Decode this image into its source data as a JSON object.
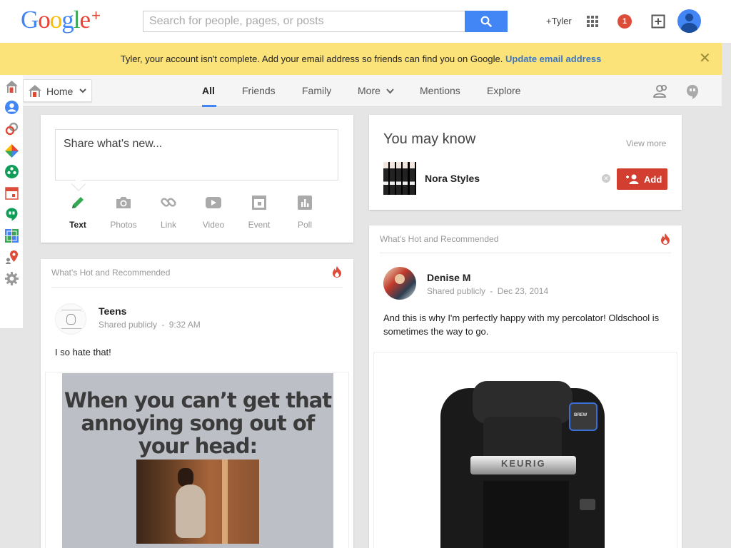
{
  "header": {
    "logo_text": "Google",
    "logo_plus": "+",
    "search_placeholder": "Search for people, pages, or posts",
    "profile_link": "+Tyler",
    "notification_count": "1"
  },
  "banner": {
    "message": "Tyler, your account isn't complete. Add your email address so friends can find you on Google.",
    "link": "Update email address",
    "close_symbol": "✕",
    "bg_color": "#fbe279"
  },
  "nav": {
    "home_label": "Home",
    "tabs": [
      "All",
      "Friends",
      "Family",
      "More",
      "Mentions",
      "Explore"
    ],
    "active_tab": "All"
  },
  "sidebar": {
    "icons": [
      "home-icon",
      "profile-icon",
      "communities-icon",
      "photos-icon",
      "events-icon",
      "calendar-icon",
      "hangouts-icon",
      "pages-icon",
      "local-icon",
      "settings-icon"
    ]
  },
  "share_box": {
    "placeholder": "Share what's new...",
    "options": [
      "Text",
      "Photos",
      "Link",
      "Video",
      "Event",
      "Poll"
    ],
    "active_option": "Text"
  },
  "you_may_know": {
    "title": "You may know",
    "view_more": "View more",
    "person_name": "Nora Styles",
    "add_label": "Add"
  },
  "posts": [
    {
      "section_label": "What's Hot and Recommended",
      "author": "Teens",
      "visibility": "Shared publicly",
      "separator": "-",
      "time": "9:32 AM",
      "text": "I so hate that!",
      "image_caption": "When you can’t get that annoying song out of your head:"
    },
    {
      "section_label": "What's Hot and Recommended",
      "author": "Denise M",
      "visibility": "Shared publicly",
      "separator": "-",
      "time": "Dec 23, 2014",
      "text": "And this is why I'm perfectly happy with my percolator! Oldschool is sometimes the way to go.",
      "image_brand": "KEURIG",
      "image_button": "BREW"
    }
  ],
  "colors": {
    "accent_blue": "#4285f4",
    "add_red": "#d23f31",
    "notification_red": "#dd4b39"
  }
}
